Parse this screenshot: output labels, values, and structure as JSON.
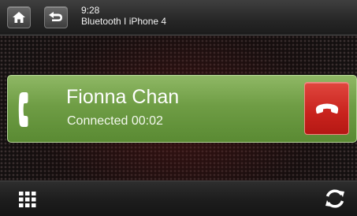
{
  "header": {
    "time": "9:28",
    "source": "Bluetooth I  iPhone 4",
    "home_icon": "home-icon",
    "back_icon": "back-arrow-icon"
  },
  "call": {
    "caller_name": "Fionna Chan",
    "status": "Connected 00:02",
    "call_icon": "phone-handset-icon",
    "end_call_icon": "end-call-icon"
  },
  "footer": {
    "menu_icon": "grid-menu-icon",
    "refresh_icon": "refresh-icon"
  },
  "colors": {
    "call_panel": "#6f9d45",
    "end_call": "#c8231d"
  }
}
